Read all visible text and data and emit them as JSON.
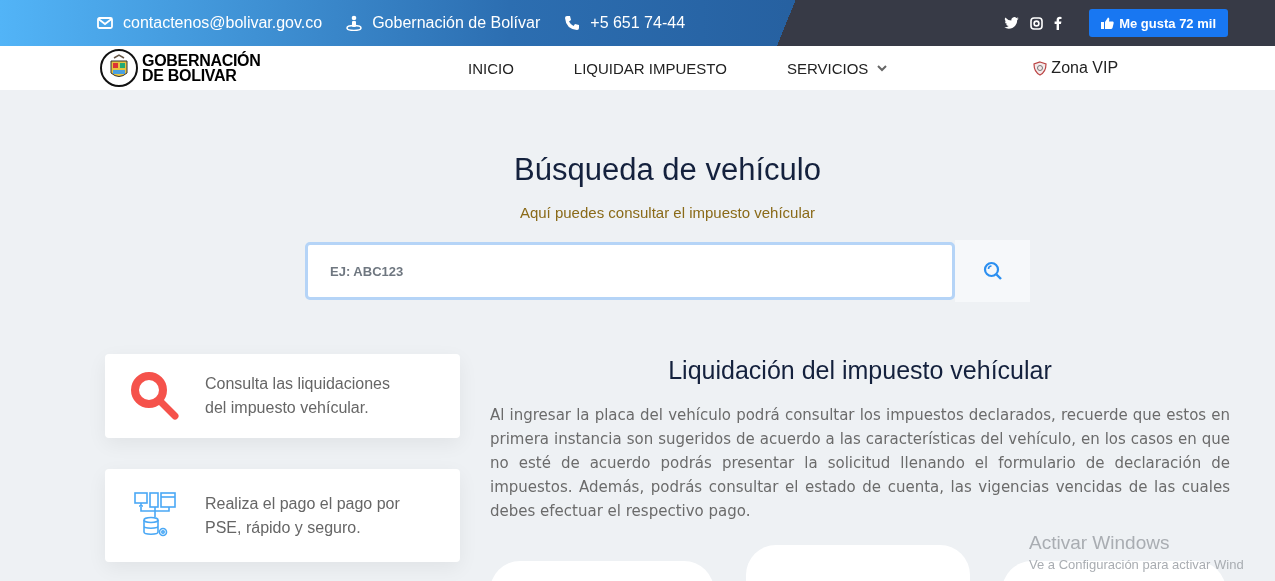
{
  "top_bar": {
    "contacts": [
      {
        "kind": "email",
        "text": "contactenos@bolivar.gov.co"
      },
      {
        "kind": "office",
        "text": "Gobernación de Bolívar"
      },
      {
        "kind": "phone",
        "text": "+5 651 74-44"
      }
    ],
    "social": [
      {
        "kind": "twitter"
      },
      {
        "kind": "instagram"
      },
      {
        "kind": "facebook"
      }
    ],
    "like_button": "Me gusta 72 mil"
  },
  "logo": {
    "lines": [
      "GOBERNACIÓN",
      "DE BOLIVAR"
    ]
  },
  "nav": {
    "items": [
      {
        "label": "INICIO",
        "kind": "link"
      },
      {
        "label": "LIQUIDAR IMPUESTO",
        "kind": "link"
      },
      {
        "label": "SERVICIOS",
        "kind": "dropdown"
      }
    ],
    "vip": "Zona VIP"
  },
  "search": {
    "title": "Búsqueda de vehículo",
    "subtitle": "Aquí puedes consultar el impuesto vehícular",
    "placeholder": "EJ: ABC123"
  },
  "features": [
    {
      "kind": "search",
      "text": "Consulta las liquidaciones del impuesto vehícular."
    },
    {
      "kind": "payment",
      "text": "Realiza el pago el pago por PSE, rápido y seguro."
    }
  ],
  "info": {
    "title": "Liquidación del impuesto vehícular",
    "body": "Al ingresar la placa del vehículo podrá consultar los impuestos declarados, recuerde que estos en primera instancia son sugeridos de acuerdo a las características del vehículo, en los casos en que no esté de acuerdo podrás presentar la solicitud llenando el formulario de declaración de impuestos. Además, podrás consultar el estado de cuenta, las vigencias vencidas de las cuales debes efectuar el respectivo pago."
  },
  "option_cards": [
    {
      "raised": false
    },
    {
      "raised": true
    },
    {
      "raised": false
    }
  ],
  "os_notice": {
    "title": "Activar Windows",
    "text": "Ve a Configuración para activar Wind"
  }
}
